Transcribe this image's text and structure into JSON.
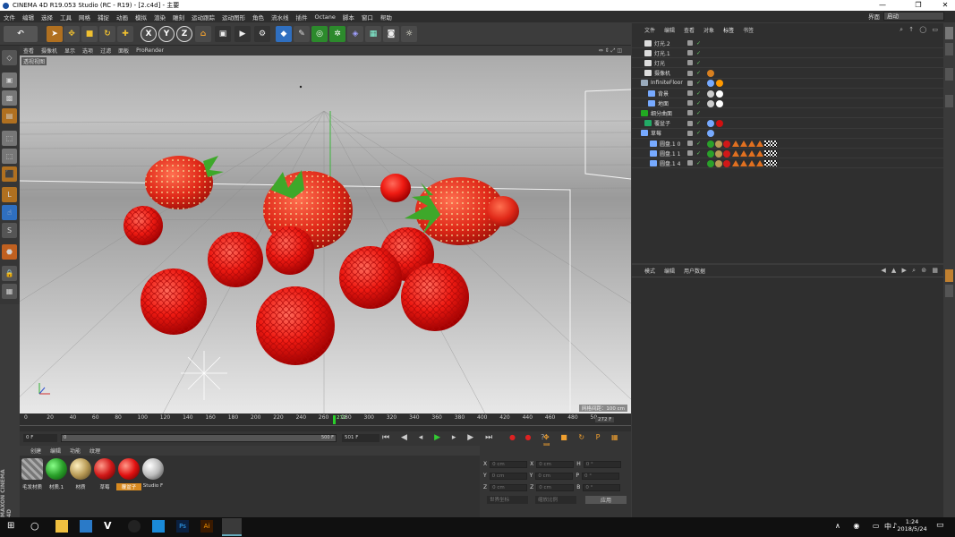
{
  "window": {
    "title": "CINEMA 4D R19.053 Studio (RC - R19) - [2.c4d] - 主要"
  },
  "menu": [
    "文件",
    "编辑",
    "选择",
    "工具",
    "网格",
    "捕捉",
    "动画",
    "模拟",
    "渲染",
    "雕刻",
    "运动跟踪",
    "运动图形",
    "角色",
    "流水线",
    "插件",
    "Octane",
    "脚本",
    "窗口",
    "帮助"
  ],
  "layout": {
    "label": "界面",
    "value": "启动"
  },
  "viewport": {
    "menu": [
      "查看",
      "摄像机",
      "显示",
      "选项",
      "过滤",
      "面板",
      "ProRender"
    ],
    "camera_label": "透视视图",
    "grid_label": "网格间距：100 cm"
  },
  "objects": {
    "tabs": [
      "文件",
      "编辑",
      "查看",
      "对象",
      "标签",
      "书签"
    ],
    "rows": [
      {
        "name": "灯光.2"
      },
      {
        "name": "灯光.1"
      },
      {
        "name": "灯光"
      },
      {
        "name": "摄像机"
      },
      {
        "name": "InfiniteFloor"
      },
      {
        "name": "背景"
      },
      {
        "name": "地面"
      },
      {
        "name": "细分曲面"
      },
      {
        "name": "覆盆子"
      },
      {
        "name": "草莓"
      },
      {
        "name": "圆盘.1 0"
      },
      {
        "name": "圆盘.1 1"
      },
      {
        "name": "圆盘.1 4"
      }
    ]
  },
  "attributes": {
    "tabs": [
      "模式",
      "编辑",
      "用户数据"
    ]
  },
  "timeline": {
    "ticks": [
      "0",
      "20",
      "40",
      "60",
      "80",
      "100",
      "120",
      "140",
      "160",
      "180",
      "200",
      "220",
      "240",
      "260",
      "280",
      "300",
      "320",
      "340",
      "360",
      "380",
      "400",
      "420",
      "440",
      "460",
      "480",
      "50"
    ],
    "current": "272",
    "end": "272 F"
  },
  "playbar": {
    "start": "0 F",
    "slider_start": "0",
    "slider_end": "500 F",
    "max": "501 F"
  },
  "materials": {
    "tabs": [
      "创建",
      "编辑",
      "功能",
      "纹理"
    ],
    "items": [
      {
        "name": "毛发材质",
        "color": "#888888"
      },
      {
        "name": "材质.1",
        "color": "#2aa02a"
      },
      {
        "name": "材质",
        "color": "#b89a55"
      },
      {
        "name": "草莓",
        "color": "#d01818"
      },
      {
        "name": "覆盆子",
        "color": "#e01010"
      },
      {
        "name": "Studio F",
        "color": "#bbbbbb"
      }
    ]
  },
  "coords": {
    "rows": [
      {
        "a": "X",
        "av": "0 cm",
        "b": "X",
        "bv": "0 cm",
        "c": "H",
        "cv": "0 °"
      },
      {
        "a": "Y",
        "av": "0 cm",
        "b": "Y",
        "bv": "0 cm",
        "c": "P",
        "cv": "0 °"
      },
      {
        "a": "Z",
        "av": "0 cm",
        "b": "Z",
        "bv": "0 cm",
        "c": "B",
        "cv": "0 °"
      }
    ],
    "mode1": "世界坐标",
    "mode2": "缩放比例",
    "apply": "应用"
  },
  "brand": {
    "line1": "MAXON",
    "line2": "CINEMA 4D"
  },
  "taskbar": {
    "time": "1:24",
    "date": "2018/5/24",
    "ime": "中"
  }
}
